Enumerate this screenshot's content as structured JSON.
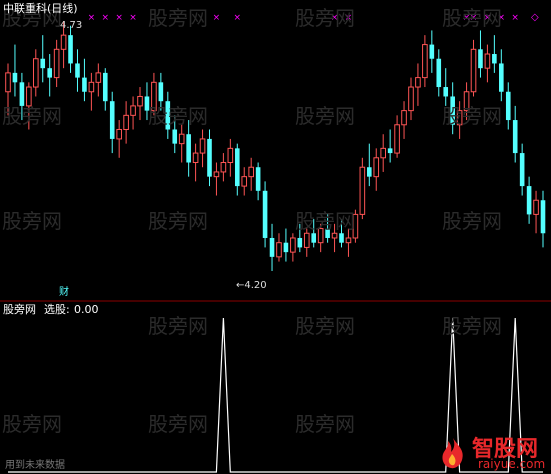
{
  "title": "中联重科(日线)",
  "high_label": "4.73",
  "low_label": "←4.20",
  "finance_marker": "财",
  "indicator": {
    "name": "股旁网",
    "formula_label": "选股:",
    "value": "0.00",
    "footer": "用到未来数据"
  },
  "watermark": "股旁网",
  "logo": {
    "name": "智股网",
    "url": "raiyue.com"
  },
  "colors": {
    "up": "#ff5555",
    "down": "#54ffff",
    "signal": "#ffffff",
    "divider": "#8b0000",
    "title": "#ffffff",
    "mark": "#ff00ff"
  },
  "chart_data": {
    "type": "candlestick",
    "price_high": 4.73,
    "price_low": 4.2,
    "candles": [
      [
        4.58,
        4.64,
        4.53,
        4.62
      ],
      [
        4.62,
        4.68,
        4.57,
        4.6
      ],
      [
        4.6,
        4.62,
        4.52,
        4.55
      ],
      [
        4.55,
        4.6,
        4.5,
        4.59
      ],
      [
        4.59,
        4.67,
        4.57,
        4.65
      ],
      [
        4.65,
        4.7,
        4.6,
        4.63
      ],
      [
        4.63,
        4.66,
        4.57,
        4.61
      ],
      [
        4.61,
        4.69,
        4.59,
        4.67
      ],
      [
        4.67,
        4.73,
        4.63,
        4.7
      ],
      [
        4.7,
        4.72,
        4.62,
        4.64
      ],
      [
        4.64,
        4.67,
        4.58,
        4.61
      ],
      [
        4.61,
        4.65,
        4.56,
        4.58
      ],
      [
        4.58,
        4.62,
        4.54,
        4.6
      ],
      [
        4.6,
        4.64,
        4.57,
        4.62
      ],
      [
        4.62,
        4.63,
        4.54,
        4.56
      ],
      [
        4.56,
        4.58,
        4.45,
        4.48
      ],
      [
        4.48,
        4.52,
        4.44,
        4.5
      ],
      [
        4.5,
        4.56,
        4.47,
        4.53
      ],
      [
        4.53,
        4.57,
        4.5,
        4.55
      ],
      [
        4.55,
        4.59,
        4.52,
        4.57
      ],
      [
        4.57,
        4.6,
        4.52,
        4.54
      ],
      [
        4.54,
        4.62,
        4.53,
        4.6
      ],
      [
        4.6,
        4.62,
        4.54,
        4.56
      ],
      [
        4.56,
        4.58,
        4.48,
        4.5
      ],
      [
        4.5,
        4.53,
        4.45,
        4.47
      ],
      [
        4.47,
        4.51,
        4.43,
        4.49
      ],
      [
        4.49,
        4.52,
        4.4,
        4.43
      ],
      [
        4.43,
        4.47,
        4.39,
        4.45
      ],
      [
        4.45,
        4.5,
        4.42,
        4.48
      ],
      [
        4.48,
        4.5,
        4.38,
        4.4
      ],
      [
        4.4,
        4.43,
        4.36,
        4.41
      ],
      [
        4.41,
        4.45,
        4.39,
        4.43
      ],
      [
        4.43,
        4.48,
        4.4,
        4.46
      ],
      [
        4.46,
        4.47,
        4.36,
        4.38
      ],
      [
        4.38,
        4.42,
        4.36,
        4.4
      ],
      [
        4.4,
        4.44,
        4.37,
        4.42
      ],
      [
        4.42,
        4.43,
        4.35,
        4.37
      ],
      [
        4.37,
        4.39,
        4.25,
        4.27
      ],
      [
        4.27,
        4.3,
        4.2,
        4.23
      ],
      [
        4.23,
        4.28,
        4.22,
        4.26
      ],
      [
        4.26,
        4.29,
        4.22,
        4.24
      ],
      [
        4.24,
        4.28,
        4.22,
        4.27
      ],
      [
        4.27,
        4.3,
        4.24,
        4.25
      ],
      [
        4.25,
        4.29,
        4.23,
        4.28
      ],
      [
        4.28,
        4.31,
        4.25,
        4.26
      ],
      [
        4.26,
        4.3,
        4.24,
        4.29
      ],
      [
        4.29,
        4.32,
        4.26,
        4.27
      ],
      [
        4.27,
        4.3,
        4.24,
        4.28
      ],
      [
        4.28,
        4.31,
        4.25,
        4.26
      ],
      [
        4.26,
        4.29,
        4.23,
        4.27
      ],
      [
        4.27,
        4.33,
        4.26,
        4.32
      ],
      [
        4.32,
        4.44,
        4.31,
        4.42
      ],
      [
        4.42,
        4.47,
        4.38,
        4.4
      ],
      [
        4.4,
        4.46,
        4.37,
        4.44
      ],
      [
        4.44,
        4.49,
        4.41,
        4.46
      ],
      [
        4.46,
        4.5,
        4.43,
        4.45
      ],
      [
        4.45,
        4.53,
        4.44,
        4.51
      ],
      [
        4.51,
        4.56,
        4.48,
        4.54
      ],
      [
        4.54,
        4.61,
        4.52,
        4.59
      ],
      [
        4.59,
        4.64,
        4.55,
        4.61
      ],
      [
        4.61,
        4.7,
        4.59,
        4.68
      ],
      [
        4.68,
        4.71,
        4.62,
        4.65
      ],
      [
        4.65,
        4.67,
        4.57,
        4.59
      ],
      [
        4.59,
        4.63,
        4.55,
        4.57
      ],
      [
        4.57,
        4.6,
        4.49,
        4.51
      ],
      [
        4.51,
        4.56,
        4.48,
        4.54
      ],
      [
        4.54,
        4.6,
        4.52,
        4.58
      ],
      [
        4.58,
        4.69,
        4.57,
        4.67
      ],
      [
        4.67,
        4.71,
        4.61,
        4.63
      ],
      [
        4.63,
        4.68,
        4.6,
        4.66
      ],
      [
        4.66,
        4.7,
        4.62,
        4.64
      ],
      [
        4.64,
        4.67,
        4.56,
        4.58
      ],
      [
        4.58,
        4.6,
        4.5,
        4.52
      ],
      [
        4.52,
        4.55,
        4.43,
        4.45
      ],
      [
        4.45,
        4.47,
        4.36,
        4.38
      ],
      [
        4.38,
        4.4,
        4.3,
        4.32
      ],
      [
        4.32,
        4.37,
        4.28,
        4.35
      ],
      [
        4.35,
        4.37,
        4.25,
        4.28
      ]
    ]
  },
  "indicator_data": {
    "type": "signal-line",
    "values": [
      0,
      0,
      0,
      0,
      0,
      0,
      0,
      0,
      0,
      0,
      0,
      0,
      0,
      0,
      0,
      0,
      0,
      0,
      0,
      0,
      0,
      0,
      0,
      0,
      0,
      0,
      0,
      0,
      0,
      0,
      0,
      1,
      0,
      0,
      0,
      0,
      0,
      0,
      0,
      0,
      0,
      0,
      0,
      0,
      0,
      0,
      0,
      0,
      0,
      0,
      0,
      0,
      0,
      0,
      0,
      0,
      0,
      0,
      0,
      0,
      0,
      0,
      0,
      0,
      1,
      0,
      0,
      0,
      0,
      0,
      0,
      0,
      0,
      1,
      0,
      0,
      0,
      0
    ]
  }
}
